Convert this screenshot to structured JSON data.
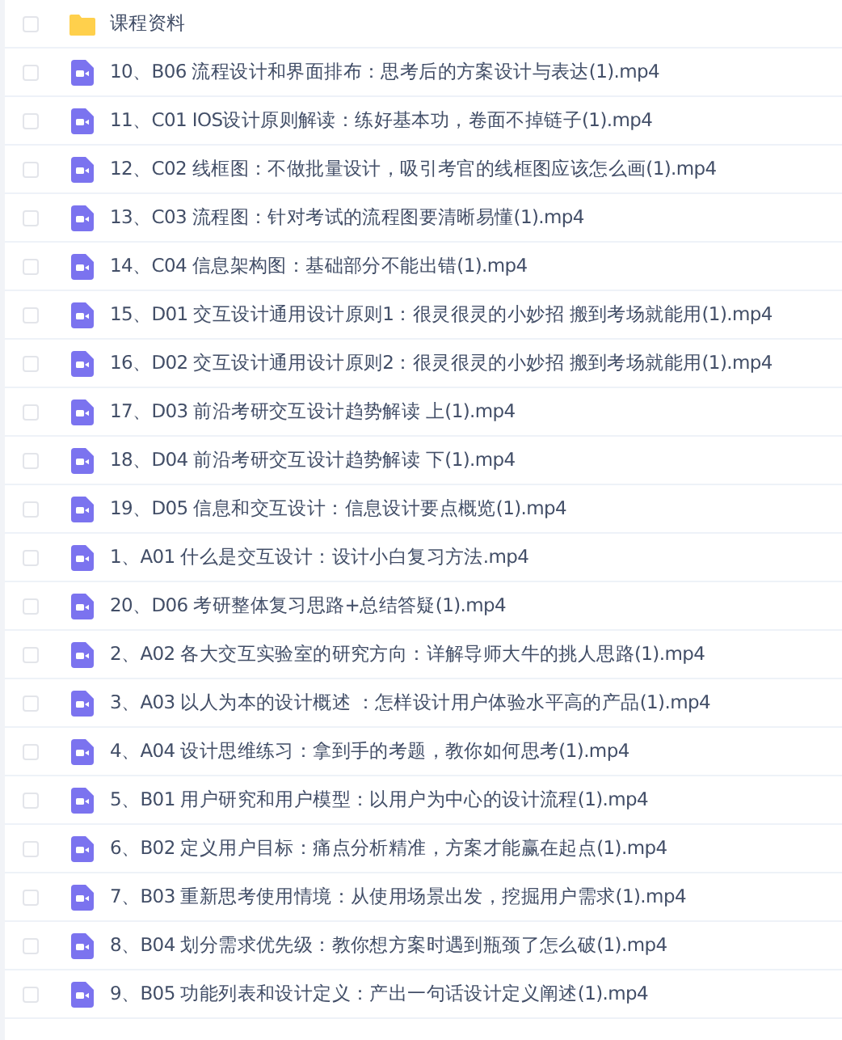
{
  "files": [
    {
      "kind": "folder",
      "name": "课程资料",
      "checked": false
    },
    {
      "kind": "video",
      "name": "10、B06 流程设计和界面排布：思考后的方案设计与表达(1).mp4",
      "checked": false
    },
    {
      "kind": "video",
      "name": "11、C01 IOS设计原则解读：练好基本功，卷面不掉链子(1).mp4",
      "checked": false
    },
    {
      "kind": "video",
      "name": "12、C02 线框图：不做批量设计，吸引考官的线框图应该怎么画(1).mp4",
      "checked": false
    },
    {
      "kind": "video",
      "name": "13、C03 流程图：针对考试的流程图要清晰易懂(1).mp4",
      "checked": false
    },
    {
      "kind": "video",
      "name": "14、C04 信息架构图：基础部分不能出错(1).mp4",
      "checked": false
    },
    {
      "kind": "video",
      "name": "15、D01 交互设计通用设计原则1：很灵很灵的小妙招 搬到考场就能用(1).mp4",
      "checked": false
    },
    {
      "kind": "video",
      "name": "16、D02 交互设计通用设计原则2：很灵很灵的小妙招 搬到考场就能用(1).mp4",
      "checked": false
    },
    {
      "kind": "video",
      "name": "17、D03 前沿考研交互设计趋势解读 上(1).mp4",
      "checked": false
    },
    {
      "kind": "video",
      "name": "18、D04 前沿考研交互设计趋势解读 下(1).mp4",
      "checked": false
    },
    {
      "kind": "video",
      "name": "19、D05 信息和交互设计：信息设计要点概览(1).mp4",
      "checked": false
    },
    {
      "kind": "video",
      "name": "1、A01 什么是交互设计：设计小白复习方法.mp4",
      "checked": false
    },
    {
      "kind": "video",
      "name": "20、D06 考研整体复习思路+总结答疑(1).mp4",
      "checked": false
    },
    {
      "kind": "video",
      "name": "2、A02 各大交互实验室的研究方向：详解导师大牛的挑人思路(1).mp4",
      "checked": false
    },
    {
      "kind": "video",
      "name": "3、A03 以人为本的设计概述 ：怎样设计用户体验水平高的产品(1).mp4",
      "checked": false
    },
    {
      "kind": "video",
      "name": "4、A04 设计思维练习：拿到手的考题，教你如何思考(1).mp4",
      "checked": false
    },
    {
      "kind": "video",
      "name": "5、B01 用户研究和用户模型：以用户为中心的设计流程(1).mp4",
      "checked": false
    },
    {
      "kind": "video",
      "name": "6、B02 定义用户目标：痛点分析精准，方案才能赢在起点(1).mp4",
      "checked": false
    },
    {
      "kind": "video",
      "name": "7、B03 重新思考使用情境：从使用场景出发，挖掘用户需求(1).mp4",
      "checked": false
    },
    {
      "kind": "video",
      "name": "8、B04 划分需求优先级：教你想方案时遇到瓶颈了怎么破(1).mp4",
      "checked": false
    },
    {
      "kind": "video",
      "name": "9、B05 功能列表和设计定义：产出一句话设计定义阐述(1).mp4",
      "checked": false
    }
  ]
}
